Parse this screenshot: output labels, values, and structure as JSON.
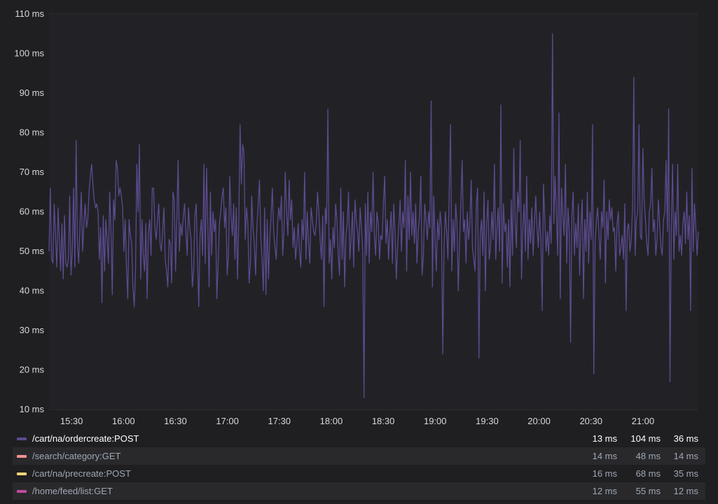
{
  "chart_data": {
    "type": "line",
    "y_axis": {
      "ticks": [
        "10 ms",
        "20 ms",
        "30 ms",
        "40 ms",
        "50 ms",
        "60 ms",
        "70 ms",
        "80 ms",
        "90 ms",
        "100 ms",
        "110 ms"
      ],
      "ylim": [
        10,
        110
      ],
      "unit": "ms"
    },
    "x_axis": {
      "ticks": [
        "15:30",
        "16:00",
        "16:30",
        "17:00",
        "17:30",
        "18:00",
        "18:30",
        "19:00",
        "19:30",
        "20:00",
        "20:30",
        "21:00"
      ],
      "xlim": [
        "15:17",
        "21:32"
      ]
    },
    "grid": true,
    "legend_placement": "bottom",
    "series": [
      {
        "name": "/cart/na/ordercreate:POST",
        "color": "#5c4b8f",
        "visible": true,
        "min": "13 ms",
        "max": "104 ms",
        "current": "36 ms",
        "x_start": "15:17",
        "x_end": "21:32",
        "values": [
          50,
          66,
          48,
          47,
          62,
          54,
          46,
          61,
          53,
          45,
          57,
          43,
          59,
          47,
          46,
          48,
          64,
          44,
          50,
          66,
          46,
          78,
          52,
          47,
          57,
          65,
          50,
          57,
          62,
          56,
          58,
          65,
          69,
          72,
          67,
          63,
          61,
          62,
          60,
          48,
          56,
          37,
          59,
          45,
          58,
          53,
          47,
          65,
          55,
          39,
          63,
          58,
          73,
          71,
          64,
          66,
          64,
          61,
          50,
          58,
          46,
          38,
          58,
          54,
          52,
          41,
          36,
          45,
          72,
          60,
          77,
          43,
          58,
          49,
          45,
          57,
          38,
          55,
          58,
          49,
          66,
          66,
          56,
          53,
          58,
          62,
          52,
          50,
          55,
          61,
          48,
          45,
          41,
          53,
          52,
          42,
          65,
          63,
          45,
          58,
          73,
          50,
          57,
          54,
          59,
          62,
          55,
          49,
          61,
          56,
          53,
          41,
          45,
          59,
          62,
          48,
          36,
          54,
          58,
          49,
          72,
          47,
          71,
          57,
          41,
          65,
          49,
          60,
          55,
          58,
          38,
          47,
          57,
          60,
          64,
          66,
          56,
          61,
          44,
          49,
          69,
          59,
          54,
          62,
          48,
          61,
          43,
          58,
          82,
          67,
          77,
          75,
          53,
          61,
          57,
          42,
          47,
          64,
          56,
          52,
          44,
          56,
          62,
          68,
          54,
          48,
          40,
          61,
          39,
          58,
          43,
          53,
          59,
          66,
          55,
          51,
          48,
          57,
          61,
          58,
          64,
          49,
          55,
          70,
          60,
          54,
          68,
          58,
          63,
          51,
          56,
          48,
          52,
          57,
          50,
          46,
          58,
          53,
          70,
          48,
          60,
          52,
          47,
          61,
          58,
          55,
          54,
          57,
          65,
          60,
          53,
          48,
          59,
          36,
          61,
          57,
          86,
          47,
          53,
          43,
          56,
          51,
          62,
          58,
          49,
          44,
          66,
          48,
          60,
          41,
          54,
          57,
          65,
          48,
          53,
          60,
          46,
          63,
          58,
          55,
          50,
          61,
          56,
          50,
          13,
          62,
          49,
          65,
          47,
          60,
          55,
          70,
          54,
          49,
          60,
          57,
          48,
          54,
          53,
          62,
          69,
          52,
          58,
          48,
          55,
          60,
          47,
          62,
          55,
          43,
          51,
          57,
          63,
          50,
          60,
          56,
          73,
          45,
          64,
          53,
          70,
          54,
          60,
          52,
          62,
          47,
          55,
          59,
          69,
          44,
          49,
          62,
          58,
          53,
          60,
          56,
          88,
          41,
          64,
          53,
          45,
          58,
          53,
          60,
          56,
          24,
          51,
          60,
          55,
          48,
          65,
          82,
          45,
          58,
          50,
          62,
          57,
          40,
          52,
          62,
          73,
          55,
          58,
          47,
          60,
          53,
          57,
          68,
          51,
          48,
          45,
          62,
          66,
          23,
          54,
          58,
          49,
          65,
          40,
          57,
          63,
          48,
          51,
          60,
          53,
          72,
          48,
          56,
          61,
          50,
          87,
          42,
          62,
          55,
          57,
          46,
          58,
          41,
          63,
          49,
          76,
          58,
          51,
          65,
          60,
          78,
          43,
          56,
          62,
          50,
          69,
          48,
          58,
          52,
          61,
          49,
          57,
          64,
          56,
          51,
          60,
          53,
          35,
          67,
          58,
          50,
          55,
          49,
          59,
          52,
          105,
          57,
          69,
          60,
          49,
          85,
          38,
          66,
          59,
          54,
          72,
          47,
          61,
          55,
          27,
          59,
          65,
          49,
          57,
          51,
          62,
          44,
          56,
          63,
          38,
          58,
          50,
          65,
          47,
          60,
          53,
          82,
          19,
          52,
          58,
          61,
          54,
          48,
          60,
          56,
          68,
          42,
          60,
          53,
          63,
          58,
          61,
          55,
          56,
          45,
          57,
          60,
          49,
          51,
          54,
          48,
          62,
          35,
          56,
          57,
          50,
          53,
          61,
          94,
          49,
          58,
          60,
          82,
          54,
          53,
          76,
          63,
          58,
          52,
          49,
          60,
          62,
          71,
          55,
          58,
          49,
          53,
          63,
          57,
          51,
          49,
          58,
          60,
          73,
          55,
          86,
          17,
          56,
          72,
          48,
          60,
          54,
          72,
          50,
          54,
          49,
          57,
          60,
          52,
          65,
          53,
          59,
          35,
          71,
          50,
          62,
          56,
          49,
          55
        ]
      },
      {
        "name": "/search/category:GET",
        "color": "#f29191",
        "visible": false,
        "min": "14 ms",
        "max": "48 ms",
        "current": "14 ms"
      },
      {
        "name": "/cart/na/precreate:POST",
        "color": "#f5d37a",
        "visible": false,
        "min": "16 ms",
        "max": "68 ms",
        "current": "35 ms"
      },
      {
        "name": "/home/feed/list:GET",
        "color": "#c04aa0",
        "visible": false,
        "min": "12 ms",
        "max": "55 ms",
        "current": "12 ms"
      }
    ]
  }
}
